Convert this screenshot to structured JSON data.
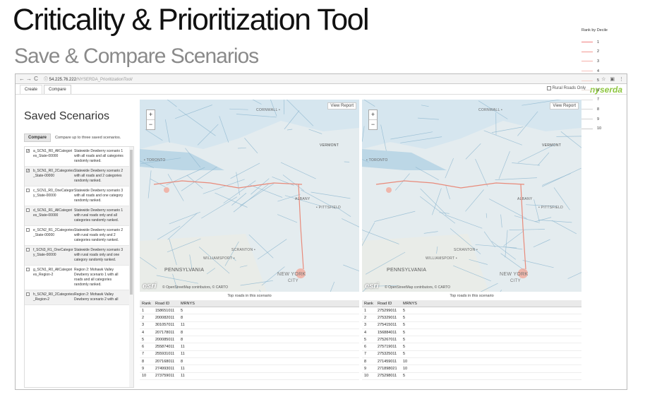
{
  "slide": {
    "title": "Criticality & Prioritization Tool",
    "subtitle": "Save & Compare Scenarios"
  },
  "browser": {
    "url_host": "54.225.76.222",
    "url_path": "/NYSERDA_PrioritizationTool/"
  },
  "tabs": [
    {
      "label": "Create"
    },
    {
      "label": "Compare"
    }
  ],
  "rural_label": "Rural Roads Only",
  "logo": "nyserda",
  "sidebar": {
    "title": "Saved Scenarios",
    "compare_button": "Compare",
    "compare_hint": "Compare up to three saved scenarios.",
    "items": [
      {
        "name": "a_SCN1_R0_AllCategories_State-00000",
        "desc": "Statewide Dewberry scenario 1 with all roads and all categories randomly ranked.",
        "checked": true
      },
      {
        "name": "b_SCN1_R0_2Categories_State-00000",
        "desc": "Statewide Dewberry scenario 2 with all roads and 2 categories randomly ranked.",
        "checked": true
      },
      {
        "name": "c_SCN1_R0_OneCategory_State-00000",
        "desc": "Statewide Dewberry scenario 3 with all roads and one category randomly ranked.",
        "checked": false
      },
      {
        "name": "d_SCN1_R1_AllCategories_State-00000",
        "desc": "Statewide Dewberry scenario 1 with rural roads only and all categories randomly ranked.",
        "checked": false
      },
      {
        "name": "e_SCN2_R1_2Categories_State-00000",
        "desc": "Statewide Dewberry scenario 2 with rural roads only and 2 categories randomly ranked.",
        "checked": false
      },
      {
        "name": "f_SCN3_R1_OneCategory_State-00000",
        "desc": "Statewide Dewberry scenario 3 with rural roads only and one category randomly ranked.",
        "checked": false
      },
      {
        "name": "g_SCN1_R0_AllCategories_Region-2",
        "desc": "Region 2: Mohawk Valley Dewberry scenario 1 with all roads and all categories randomly ranked.",
        "checked": false
      },
      {
        "name": "h_SCN2_R0_2Categories_Region-2",
        "desc": "Region 2: Mohawk Valley Dewberry scenario 2 with all",
        "checked": false
      }
    ]
  },
  "maps": [
    {
      "title": "a_SCN1_R0_AllCategories_State-00000",
      "view_report": "View Report",
      "table_caption": "Top roads in this scenario",
      "rows": [
        [
          "1",
          "158651011",
          "5"
        ],
        [
          "2",
          "200082011",
          "8"
        ],
        [
          "3",
          "301057011",
          "11"
        ],
        [
          "4",
          "207178011",
          "8"
        ],
        [
          "5",
          "200085011",
          "8"
        ],
        [
          "6",
          "255874011",
          "11"
        ],
        [
          "7",
          "255931011",
          "11"
        ],
        [
          "8",
          "207168011",
          "8"
        ],
        [
          "9",
          "274993011",
          "11"
        ],
        [
          "10",
          "273759011",
          "11"
        ]
      ]
    },
    {
      "title": "b_SCN1_R0_2Categories_State-00000",
      "view_report": "View Report",
      "table_caption": "Top roads in this scenario",
      "rows": [
        [
          "1",
          "275299011",
          "5"
        ],
        [
          "2",
          "275329011",
          "5"
        ],
        [
          "3",
          "275415011",
          "5"
        ],
        [
          "4",
          "156884011",
          "5"
        ],
        [
          "5",
          "275267011",
          "5"
        ],
        [
          "6",
          "275719011",
          "5"
        ],
        [
          "7",
          "275325011",
          "5"
        ],
        [
          "8",
          "271459011",
          "10"
        ],
        [
          "9",
          "271898021",
          "10"
        ],
        [
          "10",
          "275298011",
          "5"
        ]
      ]
    }
  ],
  "table_headers": [
    "Rank",
    "Road ID",
    "MRNYS"
  ],
  "map_labels": {
    "vermont": "VERMONT",
    "toronto": "• TORONTO",
    "pennsylvania": "PENNSYLVANIA",
    "newyork": "NEW YORK",
    "city": "CITY",
    "cornwall": "CORNWALL •",
    "pittsfield": "• PITTSFIELD",
    "scranton": "SCRANTON •",
    "williamsport": "WILLIAMSPORT •",
    "albany": "ALBANY",
    "esri": "esri",
    "attrib": "© OpenStreetMap contributors, © CARTO"
  },
  "legend": {
    "title": "Rank by Decile",
    "items": [
      "1",
      "2",
      "3",
      "4",
      "5",
      "6",
      "7",
      "8",
      "9",
      "10"
    ],
    "colors": [
      "#f08080",
      "#f39a94",
      "#f5b0aa",
      "#f6c2bc",
      "#f4d0c8",
      "#e8dcd6",
      "#dcdcdc",
      "#d6d6d6",
      "#d0d0d0",
      "#cacaca"
    ]
  }
}
